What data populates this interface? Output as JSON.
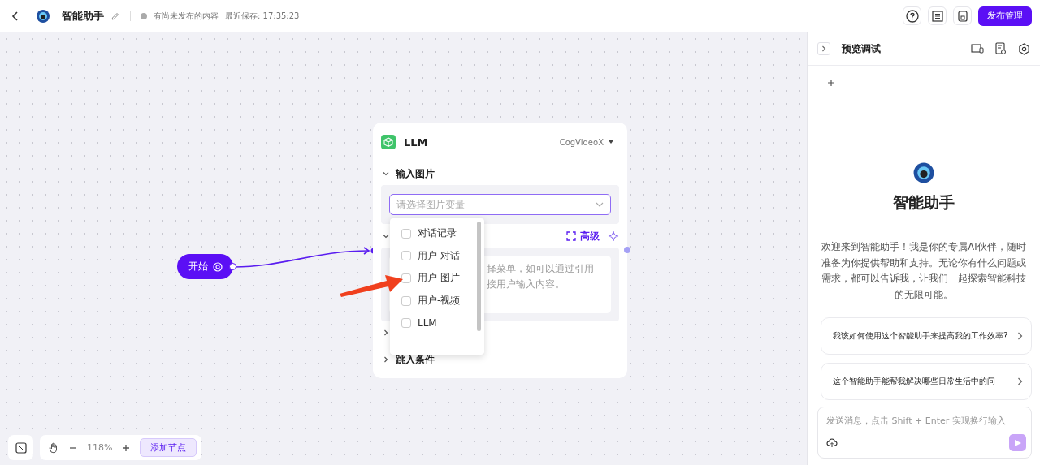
{
  "header": {
    "title": "智能助手",
    "status": "有尚未发布的内容",
    "saved": "最近保存: 17:35:23",
    "publish_button": "发布管理"
  },
  "canvas": {
    "start_node": {
      "label": "开始"
    },
    "llm_node": {
      "title": "LLM",
      "model": "CogVideoX",
      "sections": [
        {
          "title": "输入图片",
          "expanded": true
        }
      ],
      "image_select": {
        "placeholder": "请选择图片变量"
      },
      "advanced_button": "高级",
      "prompt_lines": [
        "择菜单，如可以通过引用",
        "接用户输入内容。"
      ],
      "footer_sections": [
        {
          "title": "跳入条件",
          "expanded": false
        }
      ],
      "dropdown": [
        {
          "label": "对话记录",
          "checked": false
        },
        {
          "label": "用户-对话",
          "checked": false
        },
        {
          "label": "用户-图片",
          "checked": false
        },
        {
          "label": "用户-视频",
          "checked": false
        },
        {
          "label": "LLM",
          "checked": false
        }
      ]
    },
    "zoom": "118%",
    "add_node_button": "添加节点"
  },
  "preview": {
    "title": "预览调试",
    "assistant_name": "智能助手",
    "welcome": "欢迎来到智能助手！我是你的专属AI伙伴，随时准备为你提供帮助和支持。无论你有什么问题或需求，都可以告诉我，让我们一起探索智能科技的无限可能。",
    "suggestions": [
      "我该如何使用这个智能助手来提高我的工作效率?",
      "这个智能助手能帮我解决哪些日常生活中的问"
    ],
    "input": {
      "placeholder": "发送消息，点击 Shift + Enter 实现换行输入"
    }
  }
}
